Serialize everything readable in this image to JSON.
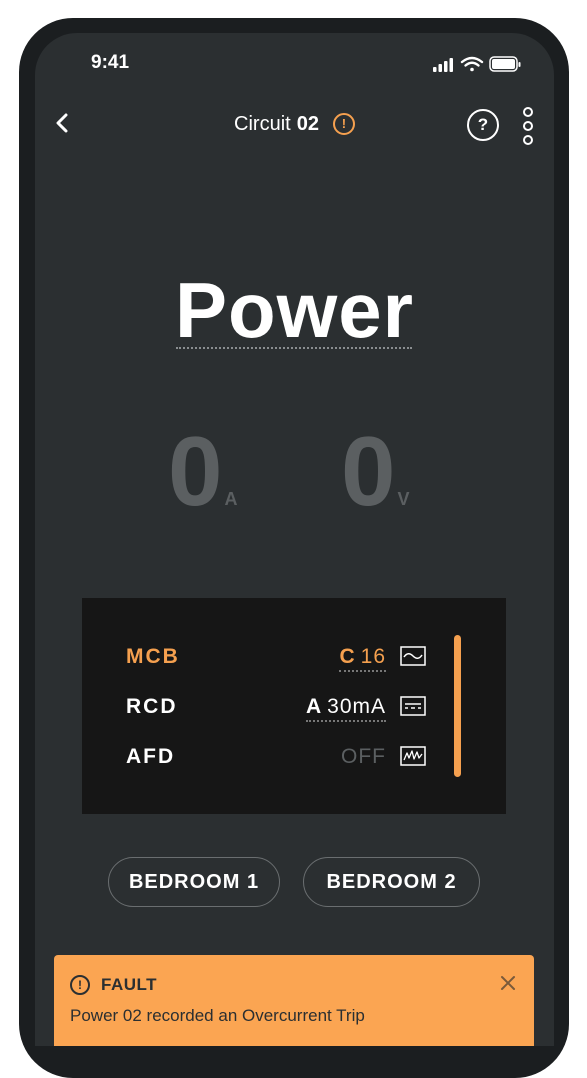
{
  "status_bar": {
    "time": "9:41"
  },
  "nav": {
    "title": "Circuit",
    "circuit_number": "02",
    "help_label": "?"
  },
  "mode": {
    "title": "Power"
  },
  "readings": [
    {
      "value": "0",
      "unit": "A"
    },
    {
      "value": "0",
      "unit": "V"
    }
  ],
  "protection": [
    {
      "label": "MCB",
      "type": "C",
      "value": "16",
      "state": "active",
      "wave_icon": "sine-wave-icon"
    },
    {
      "label": "RCD",
      "type": "A",
      "value": "30mA",
      "state": "on",
      "wave_icon": "dc-wave-icon"
    },
    {
      "label": "AFD",
      "type": "",
      "value": "OFF",
      "state": "off",
      "wave_icon": "arc-wave-icon"
    }
  ],
  "rooms": [
    "BEDROOM 1",
    "BEDROOM 2"
  ],
  "fault": {
    "title": "FAULT",
    "message": "Power 02 recorded an Overcurrent Trip",
    "icon": "!"
  },
  "colors": {
    "accent": "#f5a04f",
    "background": "#2b2f31",
    "panel": "#161616",
    "text_muted": "#5b5f61",
    "text_off": "#5b5f61"
  }
}
